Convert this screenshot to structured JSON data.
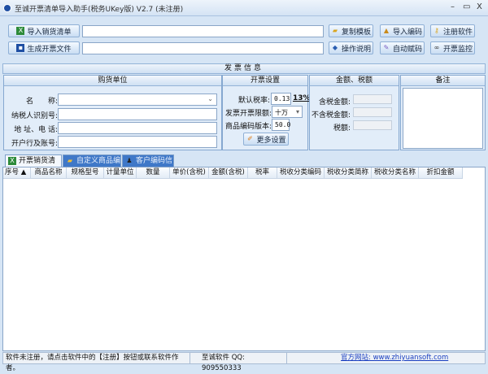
{
  "window": {
    "title": "至诚开票清单导入助手(税务UKey版) V2.7 (未注册)",
    "minimize": "–",
    "maximize": "▭",
    "close": "X"
  },
  "toolbar": {
    "import_list": "导入销货清单",
    "generate_file": "生成开票文件",
    "import_path": "",
    "output_path": "",
    "copy_template": "复制模板",
    "import_code": "导入编码",
    "register": "注册软件",
    "manual": "操作说明",
    "auto_code": "自动赋码",
    "monitor": "开票监控"
  },
  "info_title": "发票信息",
  "buyer": {
    "title": "购货单位",
    "name_label": "名　　称:",
    "tax_id_label": "纳税人识别号:",
    "address_label": "地 址、电 话:",
    "bank_label": "开户行及账号:",
    "name": "",
    "tax_id": "",
    "address": "",
    "bank": ""
  },
  "settings": {
    "title": "开票设置",
    "tax_rate_label": "默认税率:",
    "tax_rate": "0.13",
    "tax_rate_pct": "13%",
    "limit_label": "发票开票限额:",
    "limit": "十万",
    "code_version_label": "商品编码版本:",
    "code_version": "50.0",
    "more": "更多设置"
  },
  "amounts": {
    "title": "金额、税额",
    "incl_label": "含税金额:",
    "excl_label": "不含税金额:",
    "tax_label": "税额:"
  },
  "remarks": {
    "title": "备注",
    "value": ""
  },
  "tabs": [
    "开票销货清单",
    "自定义商品编码",
    "客户编码信息"
  ],
  "columns": [
    "序号 ▲",
    "商品名称",
    "规格型号",
    "计量单位",
    "数量",
    "单价(含税)",
    "金额(含税)",
    "税率",
    "税收分类编码",
    "税收分类简称",
    "税收分类名称",
    "折扣金额"
  ],
  "status": {
    "message": "软件未注册，请点击软件中的【注册】按钮或联系软件作者。",
    "qq": "至诚软件 QQ: 909550333",
    "website": "官方网站: www.zhiyuansoft.com"
  }
}
